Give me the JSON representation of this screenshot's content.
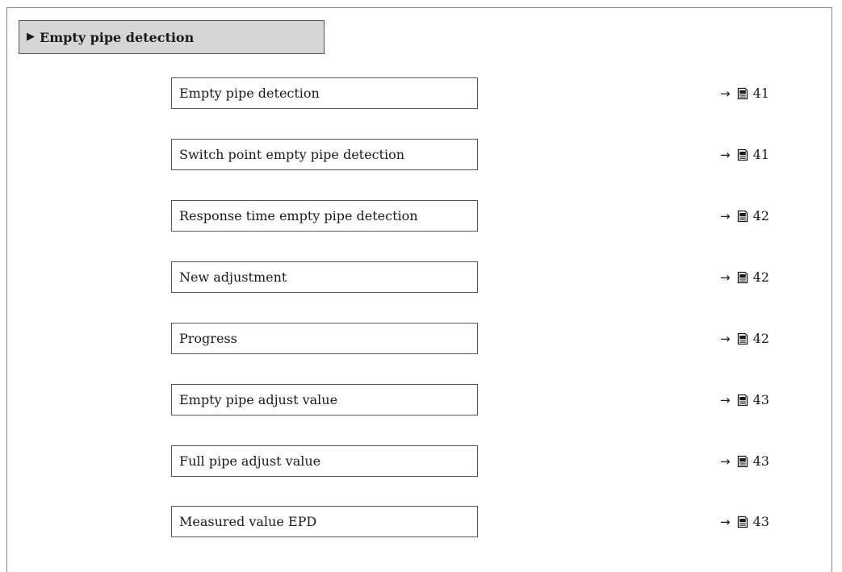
{
  "header": {
    "marker": "▶",
    "title": "Empty pipe detection"
  },
  "items": [
    {
      "label": "Empty pipe detection",
      "arrow": "→",
      "page": "41"
    },
    {
      "label": "Switch point empty pipe detection",
      "arrow": "→",
      "page": "41"
    },
    {
      "label": "Response time empty pipe detection",
      "arrow": "→",
      "page": "42"
    },
    {
      "label": "New adjustment",
      "arrow": "→",
      "page": "42"
    },
    {
      "label": "Progress",
      "arrow": "→",
      "page": "42"
    },
    {
      "label": "Empty pipe adjust value",
      "arrow": "→",
      "page": "43"
    },
    {
      "label": "Full pipe adjust value",
      "arrow": "→",
      "page": "43"
    },
    {
      "label": "Measured value EPD",
      "arrow": "→",
      "page": "43"
    }
  ],
  "icons": {
    "reference": "page-reference-icon"
  }
}
